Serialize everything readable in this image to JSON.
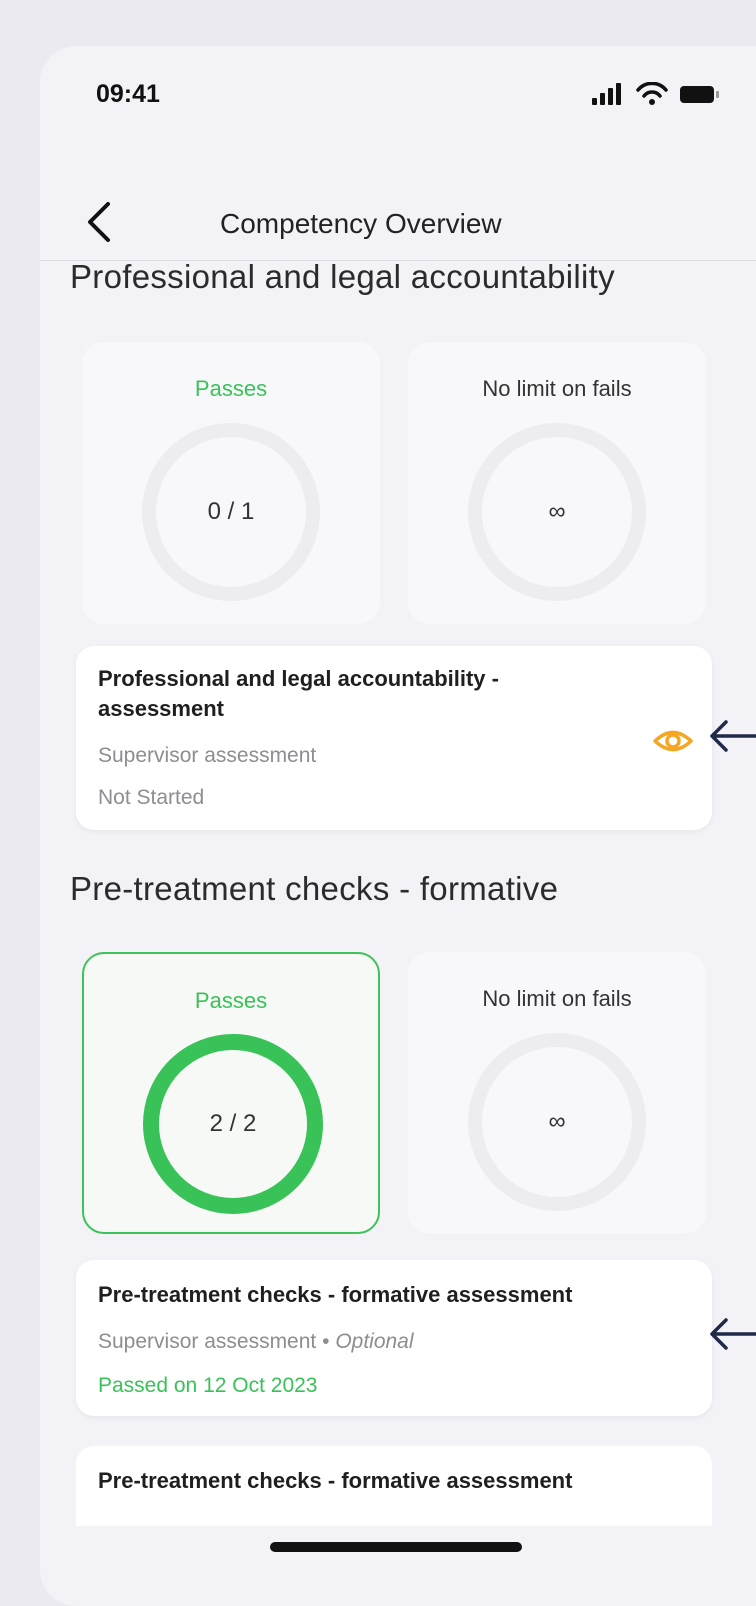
{
  "status_bar": {
    "time": "09:41"
  },
  "nav": {
    "title": "Competency Overview"
  },
  "sections": [
    {
      "title": "Professional and legal accountability",
      "passes": {
        "label": "Passes",
        "value": "0 / 1",
        "progress": 0
      },
      "fails": {
        "label": "No limit on fails",
        "value": "∞"
      },
      "items": [
        {
          "title": "Professional and legal accountability - assessment",
          "subtitle": "Supervisor assessment",
          "status": "Not Started",
          "icon": "eye-icon"
        }
      ]
    },
    {
      "title": "Pre-treatment checks - formative",
      "passes": {
        "label": "Passes",
        "value": "2 / 2",
        "progress": 1
      },
      "fails": {
        "label": "No limit on fails",
        "value": "∞"
      },
      "items": [
        {
          "title": "Pre-treatment checks - formative assessment",
          "subtitle": "Supervisor assessment",
          "separator": "•",
          "tag": "Optional",
          "status": "Passed on 12 Oct 2023"
        },
        {
          "title": "Pre-treatment checks - formative assessment"
        }
      ]
    }
  ],
  "colors": {
    "pass_green": "#39c257",
    "ring_track": "#ececf1",
    "eye_orange": "#f5a623",
    "arrow_navy": "#1f2a4a"
  }
}
